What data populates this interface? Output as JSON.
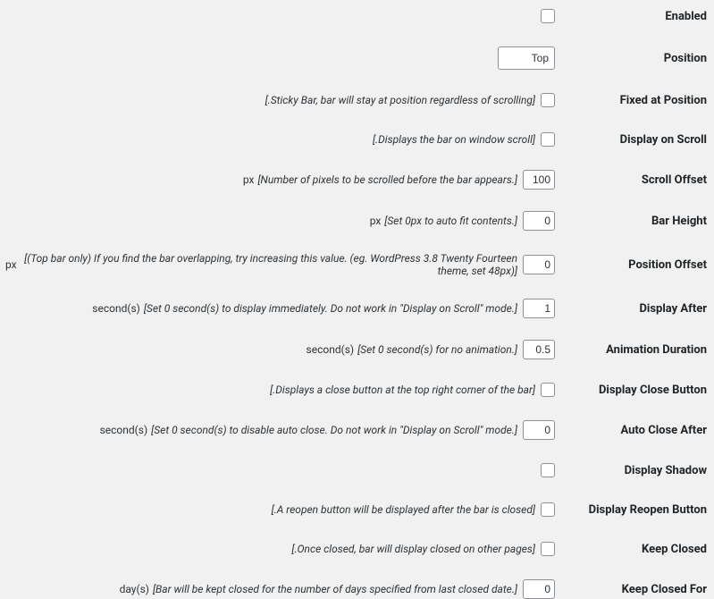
{
  "fields": {
    "enabled": {
      "label": "Enabled"
    },
    "position": {
      "label": "Position",
      "value": "Top"
    },
    "fixed": {
      "label": "Fixed at Position",
      "hint": "[.Sticky Bar, bar will stay at position regardless of scrolling]"
    },
    "displayOnScroll": {
      "label": "Display on Scroll",
      "hint": "[.Displays the bar on window scroll]"
    },
    "scrollOffset": {
      "label": "Scroll Offset",
      "unit": "px",
      "hint": "[Number of pixels to be scrolled before the bar appears.]",
      "value": "100"
    },
    "barHeight": {
      "label": "Bar Height",
      "unit": "px",
      "hint": "[Set 0px to auto fit contents.]",
      "value": "0"
    },
    "positionOffset": {
      "label": "Position Offset",
      "unit": "px",
      "hint": "[(Top bar only) If you find the bar overlapping, try increasing this value. (eg. WordPress 3.8 Twenty Fourteen theme, set 48px)]",
      "value": "0"
    },
    "displayAfter": {
      "label": "Display After",
      "unit": "second(s)",
      "hint": "[Set 0 second(s) to display immediately. Do not work in \"Display on Scroll\" mode.]",
      "value": "1"
    },
    "animationDuration": {
      "label": "Animation Duration",
      "unit": "second(s)",
      "hint": "[Set 0 second(s) for no animation.]",
      "value": "0.5"
    },
    "displayClose": {
      "label": "Display Close Button",
      "hint": "[.Displays a close button at the top right corner of the bar]"
    },
    "autoClose": {
      "label": "Auto Close After",
      "unit": "second(s)",
      "hint": "[Set 0 second(s) to disable auto close. Do not work in \"Display on Scroll\" mode.]",
      "value": "0"
    },
    "displayShadow": {
      "label": "Display Shadow"
    },
    "displayReopen": {
      "label": "Display Reopen Button",
      "hint": "[.A reopen button will be displayed after the bar is closed]"
    },
    "keepClosed": {
      "label": "Keep Closed",
      "hint": "[.Once closed, bar will display closed on other pages]"
    },
    "keepClosedFor": {
      "label": "Keep Closed For",
      "unit": "day(s)",
      "hint": "[Bar will be kept closed for the number of days specified from last closed date.]",
      "value": "0"
    }
  }
}
